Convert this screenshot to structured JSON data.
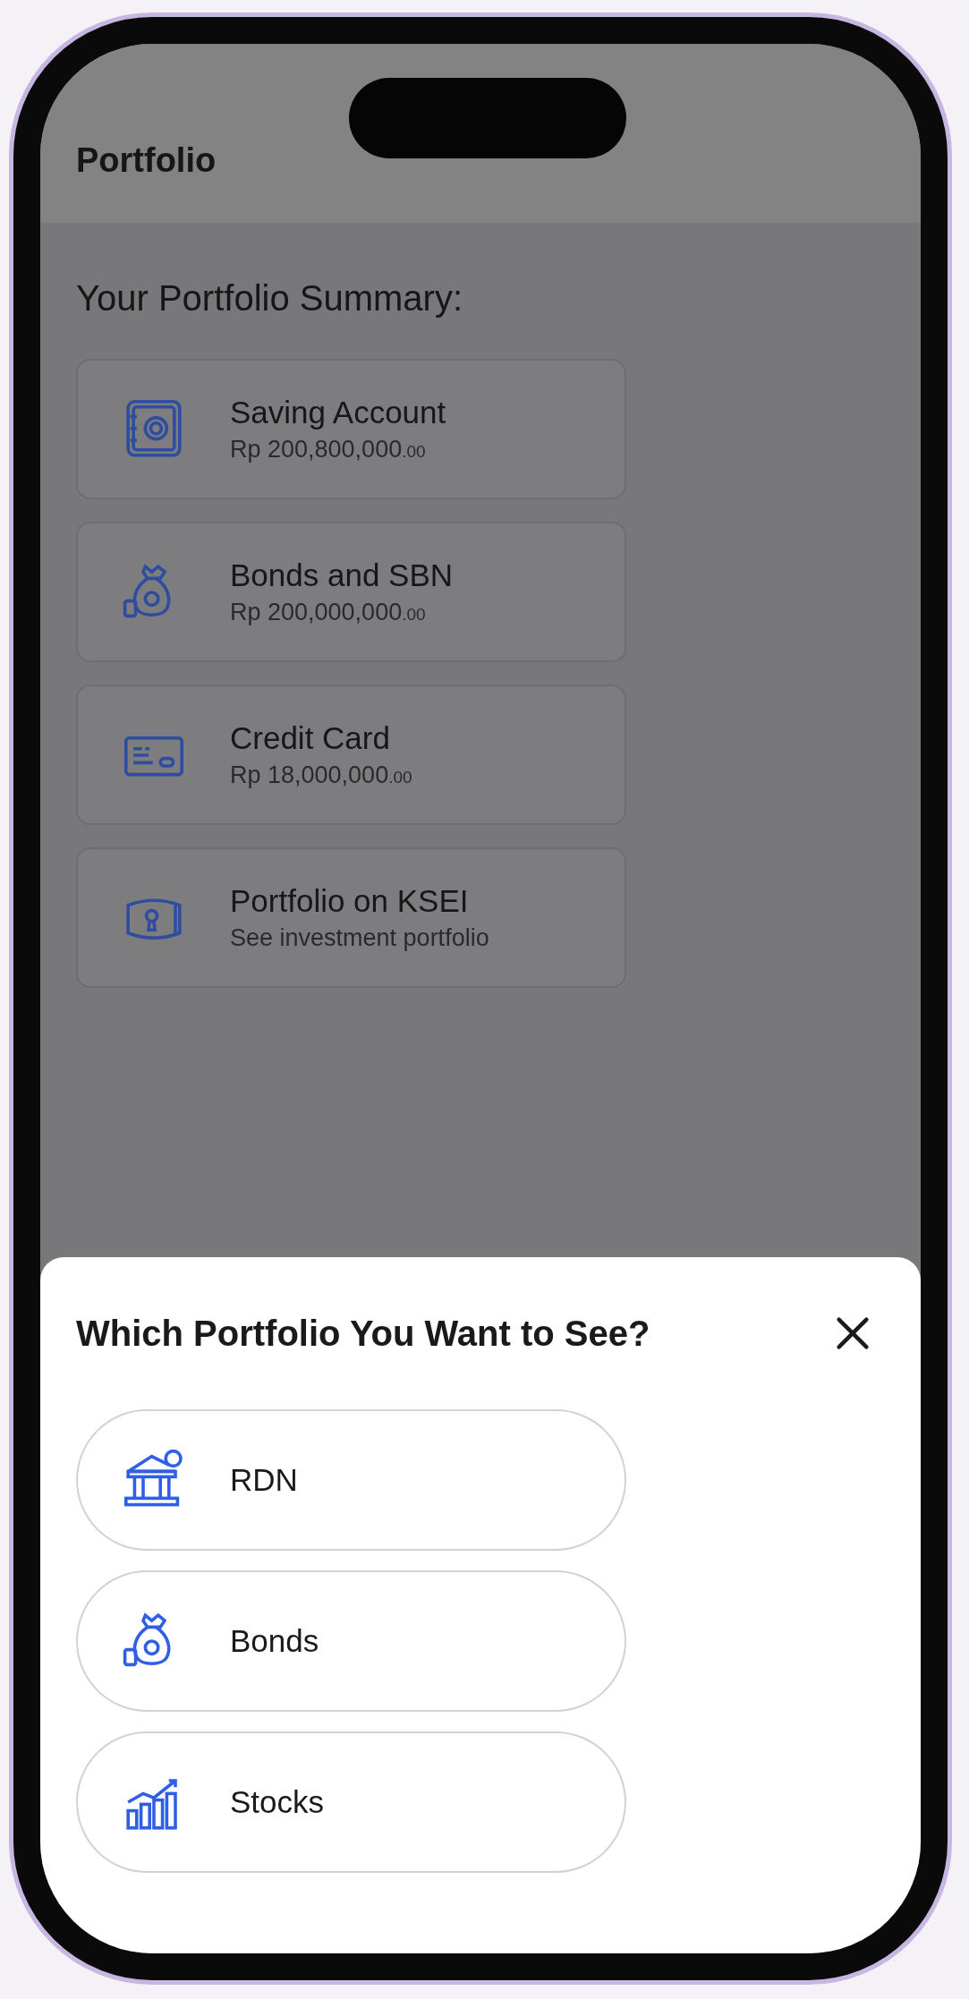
{
  "header": {
    "title": "Portfolio"
  },
  "summary": {
    "title": "Your Portfolio Summary:",
    "cards": [
      {
        "kind": "safe",
        "name": "Saving Account",
        "amount": "Rp 200,800,000",
        "decimals": ".00"
      },
      {
        "kind": "moneybag",
        "name": "Bonds and SBN",
        "amount": "Rp 200,000,000",
        "decimals": ".00"
      },
      {
        "kind": "card",
        "name": "Credit Card",
        "amount": "Rp 18,000,000",
        "decimals": ".00"
      },
      {
        "kind": "vault",
        "name": "Portfolio on KSEI",
        "amount": "See investment portfolio"
      }
    ]
  },
  "sheet": {
    "title": "Which Portfolio You Want to See?",
    "options": [
      {
        "kind": "bank",
        "label": "RDN"
      },
      {
        "kind": "moneybag",
        "label": "Bonds"
      },
      {
        "kind": "chart",
        "label": "Stocks"
      }
    ]
  }
}
